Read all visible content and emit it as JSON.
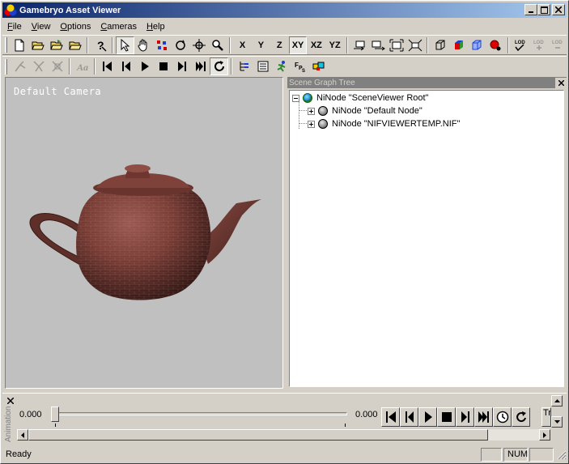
{
  "window": {
    "title": "Gamebryo Asset Viewer",
    "controls": {
      "minimize": "_",
      "maximize": "□",
      "close": "×"
    }
  },
  "menu": [
    {
      "label": "File",
      "key": "F"
    },
    {
      "label": "View",
      "key": "V"
    },
    {
      "label": "Options",
      "key": "O"
    },
    {
      "label": "Cameras",
      "key": "C"
    },
    {
      "label": "Help",
      "key": "H"
    }
  ],
  "toolbar1": {
    "axis_buttons": [
      "X",
      "Y",
      "Z",
      "XY",
      "XZ",
      "YZ"
    ],
    "lod_labels": [
      "LOD",
      "LOD +",
      "LOD -"
    ]
  },
  "toolbar2": {
    "fps_label": "FPS"
  },
  "viewport": {
    "camera_label": "Default Camera",
    "background": "#c0c0c0"
  },
  "scene_graph": {
    "title": "Scene Graph Tree",
    "close": "×",
    "nodes": [
      {
        "label": "NiNode \"SceneViewer Root\""
      },
      {
        "label": "NiNode \"Default Node\""
      },
      {
        "label": "NiNode \"NIFVIEWERTEMP.NIF\""
      }
    ]
  },
  "animation": {
    "label": "Animation",
    "close": "×",
    "start_time": "0.000",
    "end_time": "0.000",
    "position": 0,
    "tr_label": "Tr"
  },
  "status": {
    "text": "Ready",
    "num": "NUM"
  },
  "colors": {
    "titlebar_start": "#0a246a",
    "titlebar_end": "#a6caf0",
    "chrome": "#d4d0c8"
  }
}
